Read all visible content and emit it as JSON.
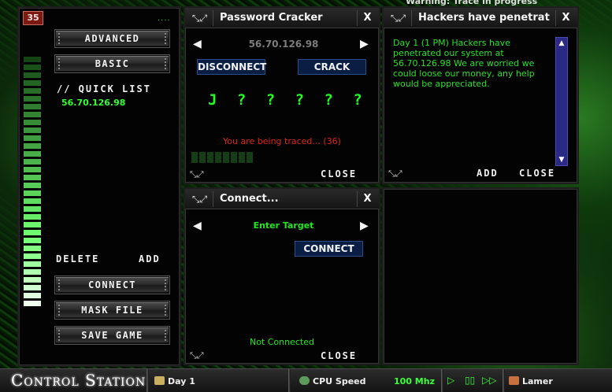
{
  "warning_text": "Warning: Trace in progress",
  "sidebar": {
    "level": "35",
    "dots": "....",
    "advanced_label": "ADVANCED",
    "basic_label": "BASIC",
    "quick_list_title": "// QUICK LIST",
    "quick_list_items": [
      "56.70.126.98"
    ],
    "delete_label": "DELETE",
    "add_label": "ADD",
    "connect_label": "CONNECT",
    "mask_file_label": "MASK FILE",
    "save_game_label": "SAVE GAME",
    "meter_colors": [
      "#144414",
      "#1a501a",
      "#1f5a1f",
      "#246424",
      "#286c28",
      "#2c742c",
      "#307c30",
      "#348434",
      "#388c38",
      "#3c943c",
      "#409c40",
      "#44a444",
      "#48ac48",
      "#4cb44c",
      "#50bc50",
      "#54c454",
      "#58cc58",
      "#5cd45c",
      "#60dc60",
      "#64e464",
      "#68ec68",
      "#6cf46c",
      "#70fc70",
      "#7aff7a",
      "#84ff84",
      "#90ff90",
      "#a0ffa0",
      "#b0ffb0",
      "#c0ffc0",
      "#d0ffd0",
      "#e0ffe0",
      "#f0fff0"
    ]
  },
  "password_cracker": {
    "resize_icon": "⤡⤢",
    "title": "Password Cracker",
    "close_x": "X",
    "host": "56.70.126.98",
    "disconnect_label": "DISCONNECT",
    "crack_label": "CRACK",
    "password": "J????????",
    "trace_text": "You are being traced... (36)",
    "progress_segments": 8,
    "close_label": "CLOSE"
  },
  "message_window": {
    "resize_icon": "⤡⤢",
    "title": "Hackers have penetrat",
    "close_x": "X",
    "message": "Day 1 (1 PM) Hackers have penetrated our system at 56.70.126.98 We are worried we could loose our money, any help would be appreciated.",
    "add_label": "ADD",
    "close_label": "CLOSE"
  },
  "connect_window": {
    "resize_icon": "⤡⤢",
    "title": "Connect...",
    "close_x": "X",
    "enter_target": "Enter Target",
    "connect_label": "CONNECT",
    "status": "Not Connected",
    "close_label": "CLOSE"
  },
  "taskbar": {
    "title": "Control Station",
    "day": "Day 1",
    "cpu_label": "CPU Speed",
    "cpu_value": "100 Mhz",
    "speed_play": "▷",
    "speed_pause": "▯▯",
    "speed_fast": "▷▷",
    "rank": "Lamer"
  },
  "colors": {
    "accent_green": "#1fff1f",
    "trace_red": "#e0241b",
    "button_blue": "#0a1e44"
  }
}
